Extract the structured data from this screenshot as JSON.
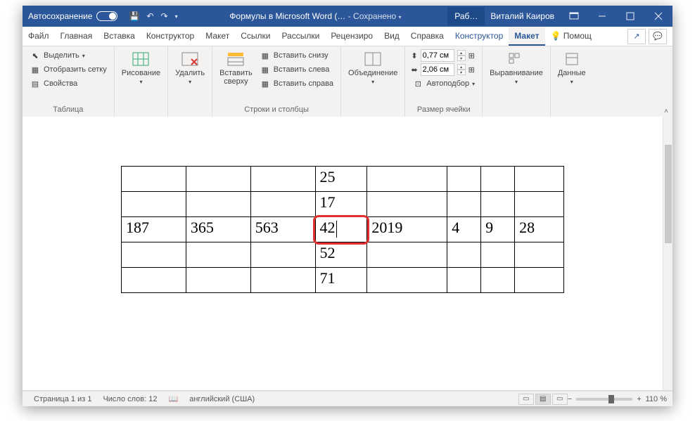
{
  "titlebar": {
    "autosave": "Автосохранение",
    "doc_title": "Формулы в Microsoft Word (…",
    "saved": "- Сохранено",
    "tab": "Раб…",
    "user": "Виталий Каиров"
  },
  "menu": {
    "file": "Файл",
    "home": "Главная",
    "insert": "Вставка",
    "design": "Конструктор",
    "layout": "Макет",
    "references": "Ссылки",
    "mailings": "Рассылки",
    "review": "Рецензиро",
    "view": "Вид",
    "help": "Справка",
    "ctx_design": "Конструктор",
    "ctx_layout": "Макет",
    "tell_me": "Помощ"
  },
  "ribbon": {
    "g_table": "Таблица",
    "select": "Выделить",
    "grid": "Отобразить сетку",
    "props": "Свойства",
    "draw": "Рисование",
    "delete": "Удалить",
    "g_rows": "Строки и столбцы",
    "ins_above": "Вставить\nсверху",
    "ins_below": "Вставить снизу",
    "ins_left": "Вставить слева",
    "ins_right": "Вставить справа",
    "merge": "Объединение",
    "g_cell": "Размер ячейки",
    "h": "0,77 см",
    "w": "2,06 см",
    "autofit": "Автоподбор",
    "align": "Выравнивание",
    "data": "Данные"
  },
  "table": {
    "rows": [
      [
        "",
        "",
        "",
        "25",
        "",
        "",
        "",
        ""
      ],
      [
        "",
        "",
        "",
        "17",
        "",
        "",
        "",
        ""
      ],
      [
        "187",
        "365",
        "563",
        "42",
        "2019",
        "4",
        "9",
        "28"
      ],
      [
        "",
        "",
        "",
        "52",
        "",
        "",
        "",
        ""
      ],
      [
        "",
        "",
        "",
        "71",
        "",
        "",
        "",
        ""
      ]
    ],
    "sel_row": 2,
    "sel_col": 3
  },
  "status": {
    "page": "Страница 1 из 1",
    "words": "Число слов: 12",
    "lang": "английский (США)",
    "zoom": "110 %"
  }
}
